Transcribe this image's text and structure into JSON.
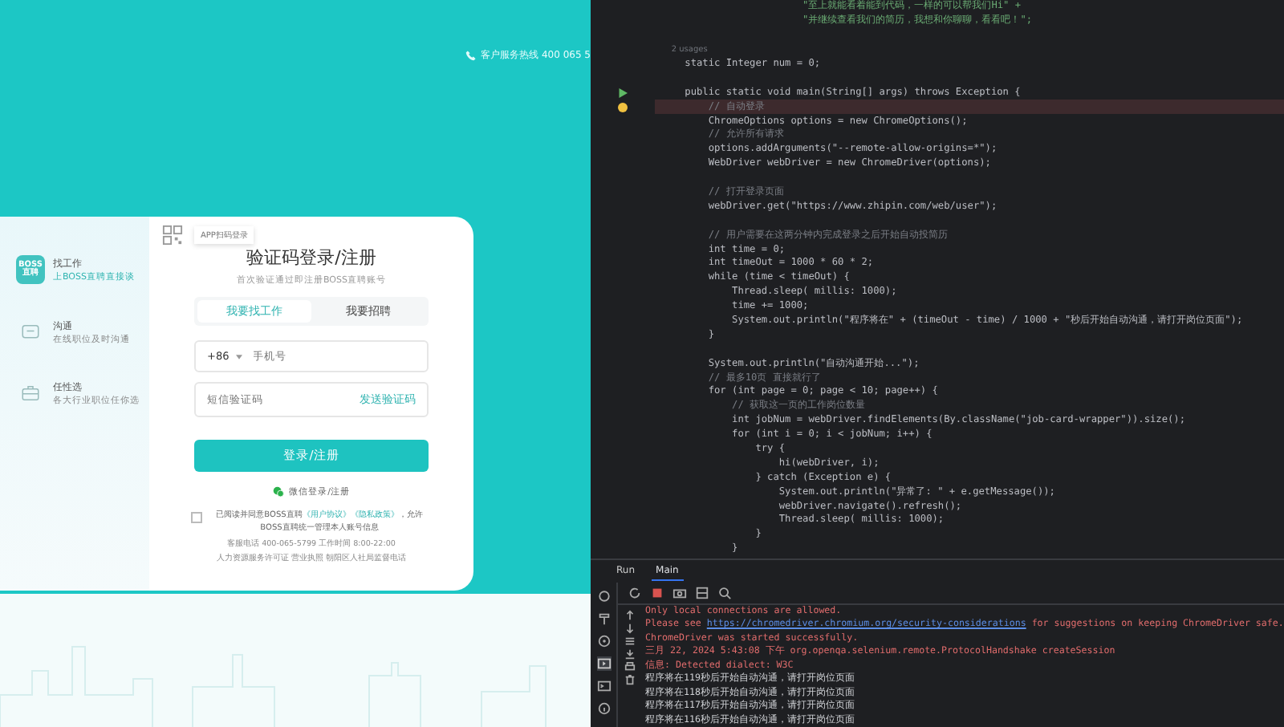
{
  "site": {
    "hotline": "客户服务热线 400 065 5",
    "card": {
      "features": [
        {
          "kind": "logo",
          "title": "找工作",
          "subtitle": "上BOSS直聘直接谈",
          "logo_lines": [
            "BOSS",
            "直聘"
          ]
        },
        {
          "kind": "chat",
          "title": "沟通",
          "subtitle": "在线职位及时沟通"
        },
        {
          "kind": "bag",
          "title": "任性选",
          "subtitle": "各大行业职位任你选"
        }
      ],
      "qr_tooltip": "APP扫码登录",
      "title": "验证码登录/注册",
      "subtitle": "首次验证通过即注册BOSS直聘账号",
      "tabs": [
        {
          "label": "我要找工作",
          "selected": true
        },
        {
          "label": "我要招聘",
          "selected": false
        }
      ],
      "phone": {
        "code": "+86",
        "placeholder": "手机号"
      },
      "sms": {
        "placeholder": "短信验证码",
        "action": "发送验证码"
      },
      "submit": "登录/注册",
      "wechat": "微信登录/注册",
      "agreement": {
        "checked": false,
        "before": "已阅读并同意BOSS直聘",
        "links": [
          "《用户协议》",
          "《隐私政策》"
        ],
        "after": "，允许BOSS直聘统一管理本人账号信息"
      },
      "footer": [
        "客服电话 400-065-5799 工作时间 8:00-22:00",
        "人力资源服务许可证 营业执照 朝阳区人社局监督电话"
      ]
    }
  },
  "editor": {
    "lines": [
      {
        "kind": "string",
        "run_marker": false,
        "breakpoint": false,
        "text": "                        \"至上就能看着能到代码，一样的可以帮我们Hi\" +"
      },
      {
        "kind": "string",
        "run_marker": false,
        "breakpoint": false,
        "text": "                        \"并继续查看我们的简历，我想和你聊聊，看看吧！\";"
      },
      {
        "kind": "blank",
        "run_marker": false,
        "breakpoint": false
      },
      {
        "kind": "hint",
        "run_marker": false,
        "breakpoint": false,
        "text": "    2 usages"
      },
      {
        "kind": "code",
        "run_marker": false,
        "breakpoint": false,
        "text": "    static Integer num = 0;"
      },
      {
        "kind": "blank",
        "run_marker": false,
        "breakpoint": false
      },
      {
        "kind": "code",
        "run_marker": true,
        "breakpoint": false,
        "text": "    public static void main(String[] args) throws Exception {"
      },
      {
        "kind": "comment",
        "run_marker": false,
        "breakpoint": true,
        "text": "        // 自动登录"
      },
      {
        "kind": "code",
        "run_marker": false,
        "breakpoint": false,
        "text": "        ChromeOptions options = new ChromeOptions();"
      },
      {
        "kind": "comment",
        "run_marker": false,
        "breakpoint": false,
        "text": "        // 允许所有请求"
      },
      {
        "kind": "code",
        "run_marker": false,
        "breakpoint": false,
        "text": "        options.addArguments(\"--remote-allow-origins=*\");"
      },
      {
        "kind": "code",
        "run_marker": false,
        "breakpoint": false,
        "text": "        WebDriver webDriver = new ChromeDriver(options);"
      },
      {
        "kind": "blank",
        "run_marker": false,
        "breakpoint": false
      },
      {
        "kind": "comment",
        "run_marker": false,
        "breakpoint": false,
        "text": "        // 打开登录页面"
      },
      {
        "kind": "code",
        "run_marker": false,
        "breakpoint": false,
        "text": "        webDriver.get(\"https://www.zhipin.com/web/user\");"
      },
      {
        "kind": "blank",
        "run_marker": false,
        "breakpoint": false
      },
      {
        "kind": "comment",
        "run_marker": false,
        "breakpoint": false,
        "text": "        // 用户需要在这两分钟内完成登录之后开始自动投简历"
      },
      {
        "kind": "code",
        "run_marker": false,
        "breakpoint": false,
        "text": "        int time = 0;"
      },
      {
        "kind": "code",
        "run_marker": false,
        "breakpoint": false,
        "text": "        int timeOut = 1000 * 60 * 2;"
      },
      {
        "kind": "code",
        "run_marker": false,
        "breakpoint": false,
        "text": "        while (time < timeOut) {"
      },
      {
        "kind": "code",
        "run_marker": false,
        "breakpoint": false,
        "text": "            Thread.sleep( millis: 1000);"
      },
      {
        "kind": "code",
        "run_marker": false,
        "breakpoint": false,
        "text": "            time += 1000;"
      },
      {
        "kind": "code",
        "run_marker": false,
        "breakpoint": false,
        "text": "            System.out.println(\"程序将在\" + (timeOut - time) / 1000 + \"秒后开始自动沟通，请打开岗位页面\");"
      },
      {
        "kind": "code",
        "run_marker": false,
        "breakpoint": false,
        "text": "        }"
      },
      {
        "kind": "blank",
        "run_marker": false,
        "breakpoint": false
      },
      {
        "kind": "code",
        "run_marker": false,
        "breakpoint": false,
        "text": "        System.out.println(\"自动沟通开始...\");"
      },
      {
        "kind": "comment",
        "run_marker": false,
        "breakpoint": false,
        "text": "        // 最多10页 直接就行了"
      },
      {
        "kind": "code",
        "run_marker": false,
        "breakpoint": false,
        "text": "        for (int page = 0; page < 10; page++) {"
      },
      {
        "kind": "comment",
        "run_marker": false,
        "breakpoint": false,
        "text": "            // 获取这一页的工作岗位数量"
      },
      {
        "kind": "code",
        "run_marker": false,
        "breakpoint": false,
        "text": "            int jobNum = webDriver.findElements(By.className(\"job-card-wrapper\")).size();"
      },
      {
        "kind": "code",
        "run_marker": false,
        "breakpoint": false,
        "text": "            for (int i = 0; i < jobNum; i++) {"
      },
      {
        "kind": "code",
        "run_marker": false,
        "breakpoint": false,
        "text": "                try {"
      },
      {
        "kind": "code",
        "run_marker": false,
        "breakpoint": false,
        "text": "                    hi(webDriver, i);"
      },
      {
        "kind": "code",
        "run_marker": false,
        "breakpoint": false,
        "text": "                } catch (Exception e) {"
      },
      {
        "kind": "code",
        "run_marker": false,
        "breakpoint": false,
        "text": "                    System.out.println(\"异常了: \" + e.getMessage());"
      },
      {
        "kind": "code",
        "run_marker": false,
        "breakpoint": false,
        "text": "                    webDriver.navigate().refresh();"
      },
      {
        "kind": "code",
        "run_marker": false,
        "breakpoint": false,
        "text": "                    Thread.sleep( millis: 1000);"
      },
      {
        "kind": "code",
        "run_marker": false,
        "breakpoint": false,
        "text": "                }"
      },
      {
        "kind": "code",
        "run_marker": false,
        "breakpoint": false,
        "text": "            }"
      }
    ]
  },
  "run_panel": {
    "title": "Run",
    "tabs": [
      {
        "label": "Main",
        "selected": true
      }
    ],
    "console": [
      {
        "kind": "error",
        "text": "Only local connections are allowed."
      },
      {
        "kind": "error",
        "text": "Please see ",
        "link": "https://chromedriver.chromium.org/security-considerations",
        "after": " for suggestions on keeping ChromeDriver safe."
      },
      {
        "kind": "error",
        "text": "ChromeDriver was started successfully."
      },
      {
        "kind": "error",
        "text": "三月 22, 2024 5:43:08 下午 org.openqa.selenium.remote.ProtocolHandshake createSession"
      },
      {
        "kind": "error",
        "text": "信息: Detected dialect: W3C"
      },
      {
        "kind": "out",
        "text": "程序将在119秒后开始自动沟通，请打开岗位页面"
      },
      {
        "kind": "out",
        "text": "程序将在118秒后开始自动沟通，请打开岗位页面"
      },
      {
        "kind": "out",
        "text": "程序将在117秒后开始自动沟通，请打开岗位页面"
      },
      {
        "kind": "out",
        "text": "程序将在116秒后开始自动沟通，请打开岗位页面"
      }
    ]
  }
}
